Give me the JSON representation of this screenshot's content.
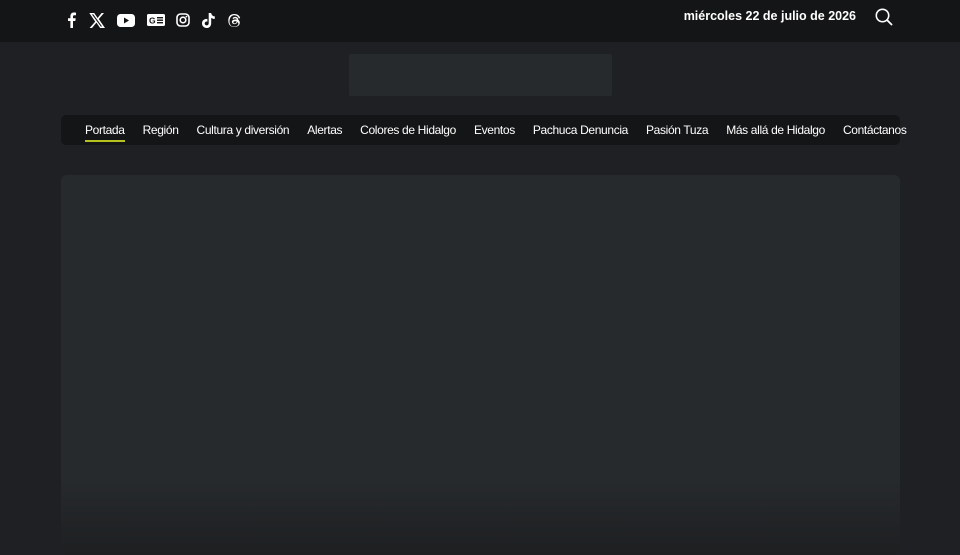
{
  "header": {
    "date": "miércoles 22 de julio de 2026",
    "social_icons": [
      "facebook-icon",
      "x-twitter-icon",
      "youtube-icon",
      "google-news-icon",
      "instagram-icon",
      "tiktok-icon",
      "threads-icon"
    ],
    "search_icon": "search-icon"
  },
  "nav": {
    "items": [
      {
        "label": "Portada",
        "active": true
      },
      {
        "label": "Región"
      },
      {
        "label": "Cultura y diversión"
      },
      {
        "label": "Alertas"
      },
      {
        "label": "Colores de Hidalgo"
      },
      {
        "label": "Eventos"
      },
      {
        "label": "Pachuca Denuncia"
      },
      {
        "label": "Pasión Tuza"
      },
      {
        "label": "Más allá de Hidalgo"
      },
      {
        "label": "Contáctanos"
      }
    ]
  },
  "colors": {
    "page_bg": "#1e2023",
    "topbar_bg": "#141516",
    "placeholder": "#272a2d",
    "active_underline": "#b5c21d"
  }
}
